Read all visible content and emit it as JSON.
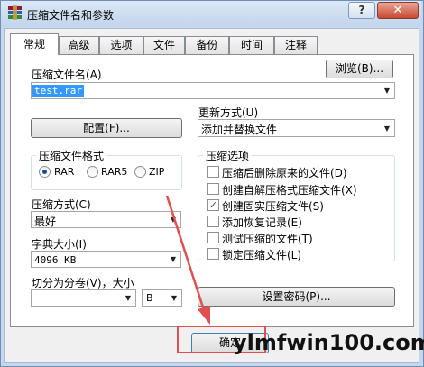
{
  "window": {
    "title": "压缩文件名和参数",
    "help_label": "?",
    "close_label": "✕"
  },
  "tabs": [
    {
      "label": "常规",
      "active": true
    },
    {
      "label": "高级"
    },
    {
      "label": "选项"
    },
    {
      "label": "文件"
    },
    {
      "label": "备份"
    },
    {
      "label": "时间"
    },
    {
      "label": "注释"
    }
  ],
  "general": {
    "archive_name_label": "压缩文件名(A)",
    "browse_label": "浏览(B)...",
    "archive_name_value": "test.rar",
    "update_mode_label": "更新方式(U)",
    "update_mode_value": "添加并替换文件",
    "profiles_label": "配置(F)...",
    "format_group_title": "压缩文件格式",
    "formats": [
      {
        "label": "RAR",
        "selected": true
      },
      {
        "label": "RAR5",
        "selected": false
      },
      {
        "label": "ZIP",
        "selected": false
      }
    ],
    "options_group_title": "压缩选项",
    "options": [
      {
        "label": "压缩后删除原来的文件(D)",
        "checked": false
      },
      {
        "label": "创建自解压格式压缩文件(X)",
        "checked": false
      },
      {
        "label": "创建固实压缩文件(S)",
        "checked": true
      },
      {
        "label": "添加恢复记录(E)",
        "checked": false
      },
      {
        "label": "测试压缩的文件(T)",
        "checked": false
      },
      {
        "label": "锁定压缩文件(L)",
        "checked": false
      }
    ],
    "method_label": "压缩方式(C)",
    "method_value": "最好",
    "dict_label": "字典大小(I)",
    "dict_value": "4096 KB",
    "split_label": "切分为分卷(V)，大小",
    "split_value": "",
    "split_unit": "B",
    "password_label": "设置密码(P)..."
  },
  "footer": {
    "ok_label": "确定"
  },
  "watermark": "ylmfwin100.com",
  "colors": {
    "highlight_border": "#e05050",
    "selection_bg": "#3399ff",
    "title_bar": "#c5d7ec",
    "close_button": "#c64b34"
  }
}
